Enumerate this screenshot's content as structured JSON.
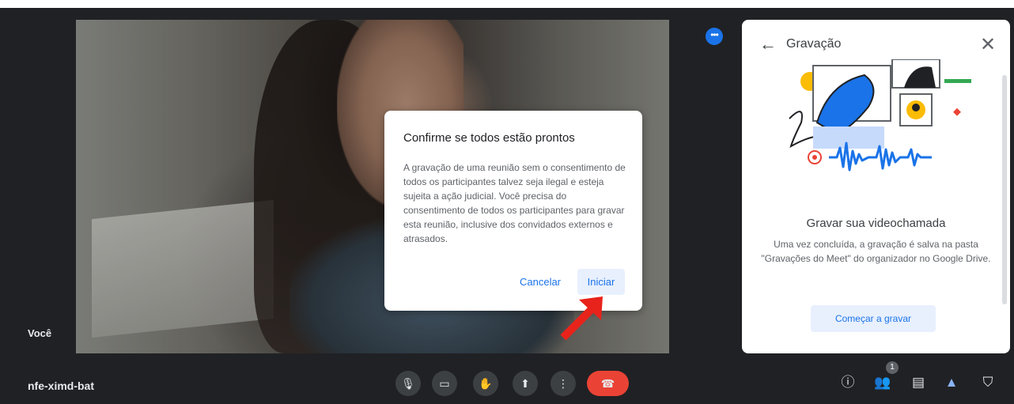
{
  "video": {
    "self_label": "Você"
  },
  "dialog": {
    "title": "Confirme se todos estão prontos",
    "body": "A gravação de uma reunião sem o consentimento de todos os participantes talvez seja ilegal e esteja sujeita a ação judicial. Você precisa do consentimento de todos os participantes para gravar esta reunião, inclusive dos convidados externos e atrasados.",
    "cancel_label": "Cancelar",
    "start_label": "Iniciar"
  },
  "panel": {
    "title": "Gravação",
    "heading": "Gravar sua videochamada",
    "description": "Uma vez concluída, a gravação é salva na pasta \"Gravações do Meet\" do organizador no Google Drive.",
    "start_button": "Começar a gravar"
  },
  "bottom_bar": {
    "meeting_code": "nfe-ximd-bat",
    "participant_count": "1"
  },
  "colors": {
    "accent": "#1a73e8",
    "hangup": "#ea4335",
    "background": "#202124"
  }
}
